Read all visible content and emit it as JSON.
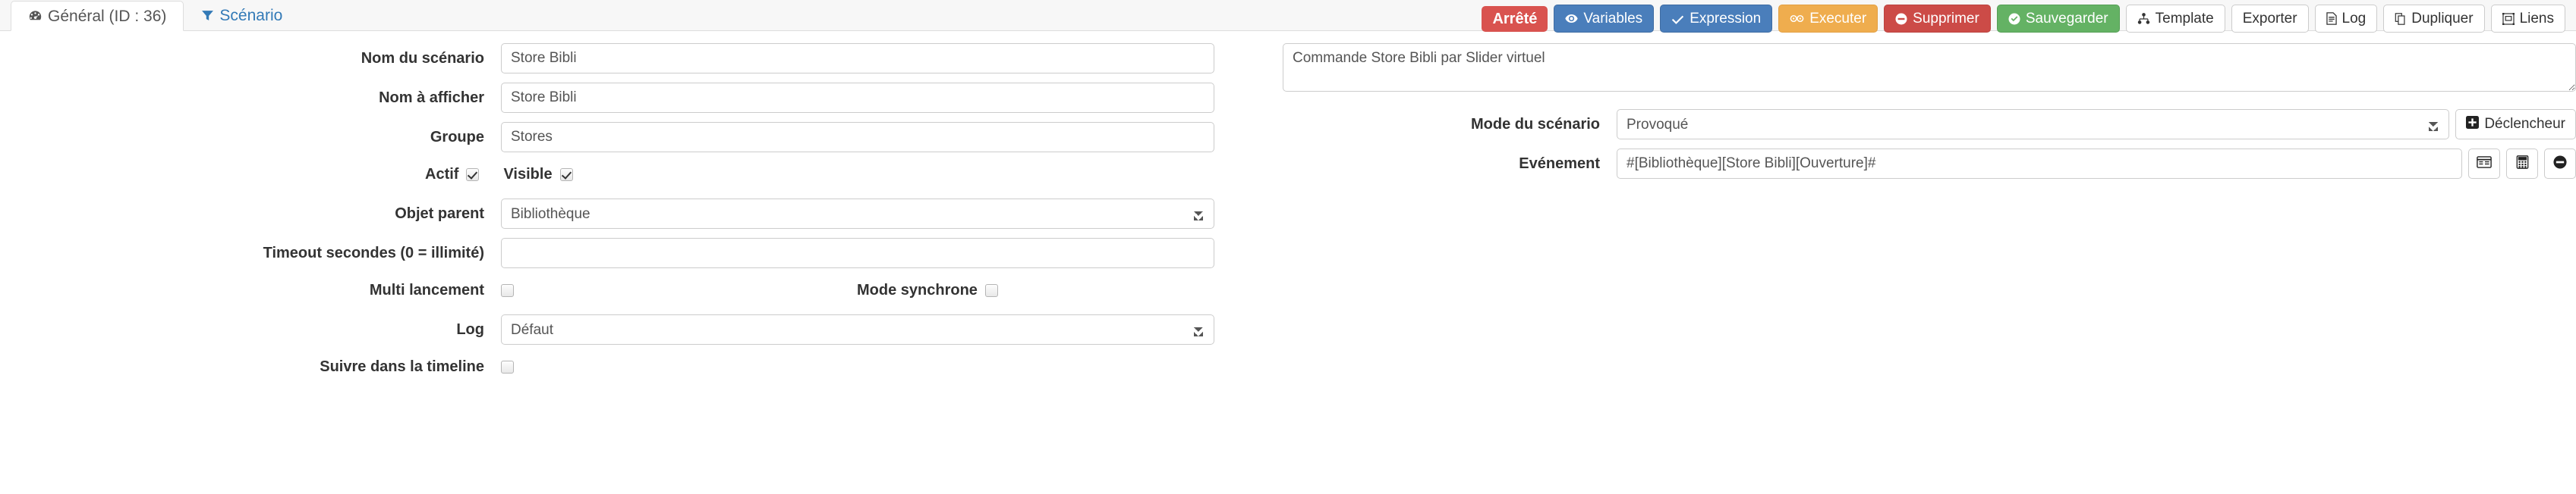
{
  "tabs": [
    {
      "label": "Général (ID : 36)",
      "icon": "dashboard-icon",
      "active": true
    },
    {
      "label": "Scénario",
      "icon": "filter-icon",
      "active": false
    }
  ],
  "toolbar": {
    "status_badge": "Arrêté",
    "buttons": [
      {
        "label": "Variables",
        "icon": "eye-icon",
        "style": "blue"
      },
      {
        "label": "Expression",
        "icon": "check-icon",
        "style": "blue"
      },
      {
        "label": "Executer",
        "icon": "gears-icon",
        "style": "orange"
      },
      {
        "label": "Supprimer",
        "icon": "minus-circle-icon",
        "style": "red"
      },
      {
        "label": "Sauvegarder",
        "icon": "check-circle-icon",
        "style": "green"
      },
      {
        "label": "Template",
        "icon": "sitemap-icon",
        "style": "default"
      },
      {
        "label": "Exporter",
        "icon": "",
        "style": "default"
      },
      {
        "label": "Log",
        "icon": "file-text-icon",
        "style": "default"
      },
      {
        "label": "Dupliquer",
        "icon": "copy-icon",
        "style": "default"
      },
      {
        "label": "Liens",
        "icon": "link-nodes-icon",
        "style": "default"
      }
    ]
  },
  "left": {
    "nom_scenario": {
      "label": "Nom du scénario",
      "value": "Store Bibli",
      "placeholder": "Nom du scénario"
    },
    "nom_afficher": {
      "label": "Nom à afficher",
      "value": "Store Bibli",
      "placeholder": "Nom à afficher"
    },
    "groupe": {
      "label": "Groupe",
      "value": "Stores",
      "placeholder": "Groupe"
    },
    "actif": {
      "label": "Actif",
      "checked": true
    },
    "visible": {
      "label": "Visible",
      "checked": true
    },
    "objet_parent": {
      "label": "Objet parent",
      "value": "Bibliothèque"
    },
    "timeout": {
      "label": "Timeout secondes (0 = illimité)",
      "value": "",
      "placeholder": ""
    },
    "multi_lancement": {
      "label": "Multi lancement",
      "checked": false
    },
    "mode_synchrone": {
      "label": "Mode synchrone",
      "checked": false
    },
    "log": {
      "label": "Log",
      "value": "Défaut"
    },
    "timeline": {
      "label": "Suivre dans la timeline",
      "checked": false
    }
  },
  "right": {
    "description": {
      "value": "Commande Store Bibli par Slider virtuel",
      "placeholder": "Description"
    },
    "mode_scenario": {
      "label": "Mode du scénario",
      "value": "Provoqué",
      "trigger_button": {
        "label": "Déclencheur",
        "icon": "plus-square-icon"
      }
    },
    "evenement": {
      "label": "Evénement",
      "value": "#[Bibliothèque][Store Bibli][Ouverture]#",
      "placeholder": "Evénement",
      "actions": [
        {
          "icon": "window-list-icon",
          "name": "select-object-button"
        },
        {
          "icon": "calculator-icon",
          "name": "expression-button"
        },
        {
          "icon": "minus-circle-icon",
          "name": "remove-event-button"
        }
      ]
    }
  },
  "colors": {
    "blue": "#4a7ebb",
    "orange": "#efad4e",
    "red": "#cc4b47",
    "green": "#64b264",
    "badge_red": "#d9534f",
    "link": "#337ab7"
  }
}
